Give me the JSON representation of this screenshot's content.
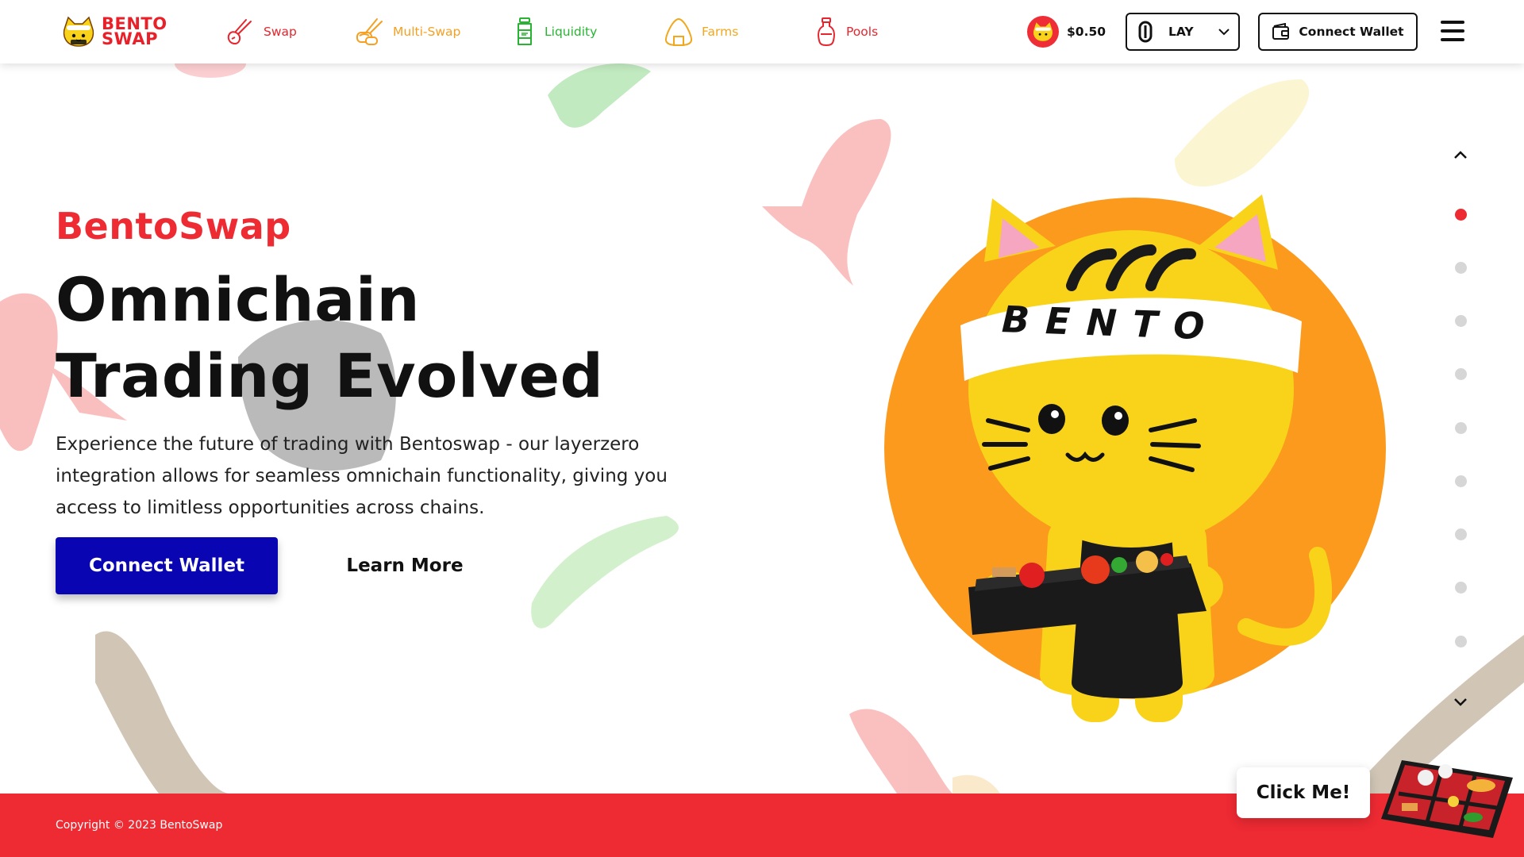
{
  "app": {
    "logo_text_line1": "BENTO",
    "logo_text_line2": "SWAP"
  },
  "nav": {
    "items": [
      {
        "label": "Swap",
        "color": "#e8242d",
        "icon": "chopsticks-dumpling-icon"
      },
      {
        "label": "Multi-Swap",
        "color": "#f5a023",
        "icon": "sushi-chopsticks-icon"
      },
      {
        "label": "Liquidity",
        "color": "#28b432",
        "icon": "bottle-icon"
      },
      {
        "label": "Farms",
        "color": "#f2a81e",
        "icon": "onigiri-icon"
      },
      {
        "label": "Pools",
        "color": "#e8242d",
        "icon": "sauce-bottle-icon"
      }
    ]
  },
  "header": {
    "token_price": "$0.50",
    "chain_label": "LAY",
    "connect_wallet_label": "Connect Wallet"
  },
  "hero": {
    "brand": "BentoSwap",
    "headline_line1": "Omnichain",
    "headline_line2": "Trading Evolved",
    "lead": "Experience the future of trading with Bentoswap - our layerzero integration allows for seamless omnichain functionality, giving you access to limitless opportunities across chains.",
    "connect_wallet_label": "Connect Wallet",
    "learn_more_label": "Learn More",
    "mascot_headband_text": "BENTO"
  },
  "pager": {
    "dot_count": 9,
    "active_index": 0
  },
  "footer": {
    "copyright": "Copyright © 2023 BentoSwap",
    "click_me_label": "Click Me!"
  },
  "colors": {
    "brand_red": "#ee2a33",
    "cta_blue": "#0a05b2",
    "mascot_yellow": "#f8d31a",
    "sun_orange": "#fb9a1d"
  }
}
